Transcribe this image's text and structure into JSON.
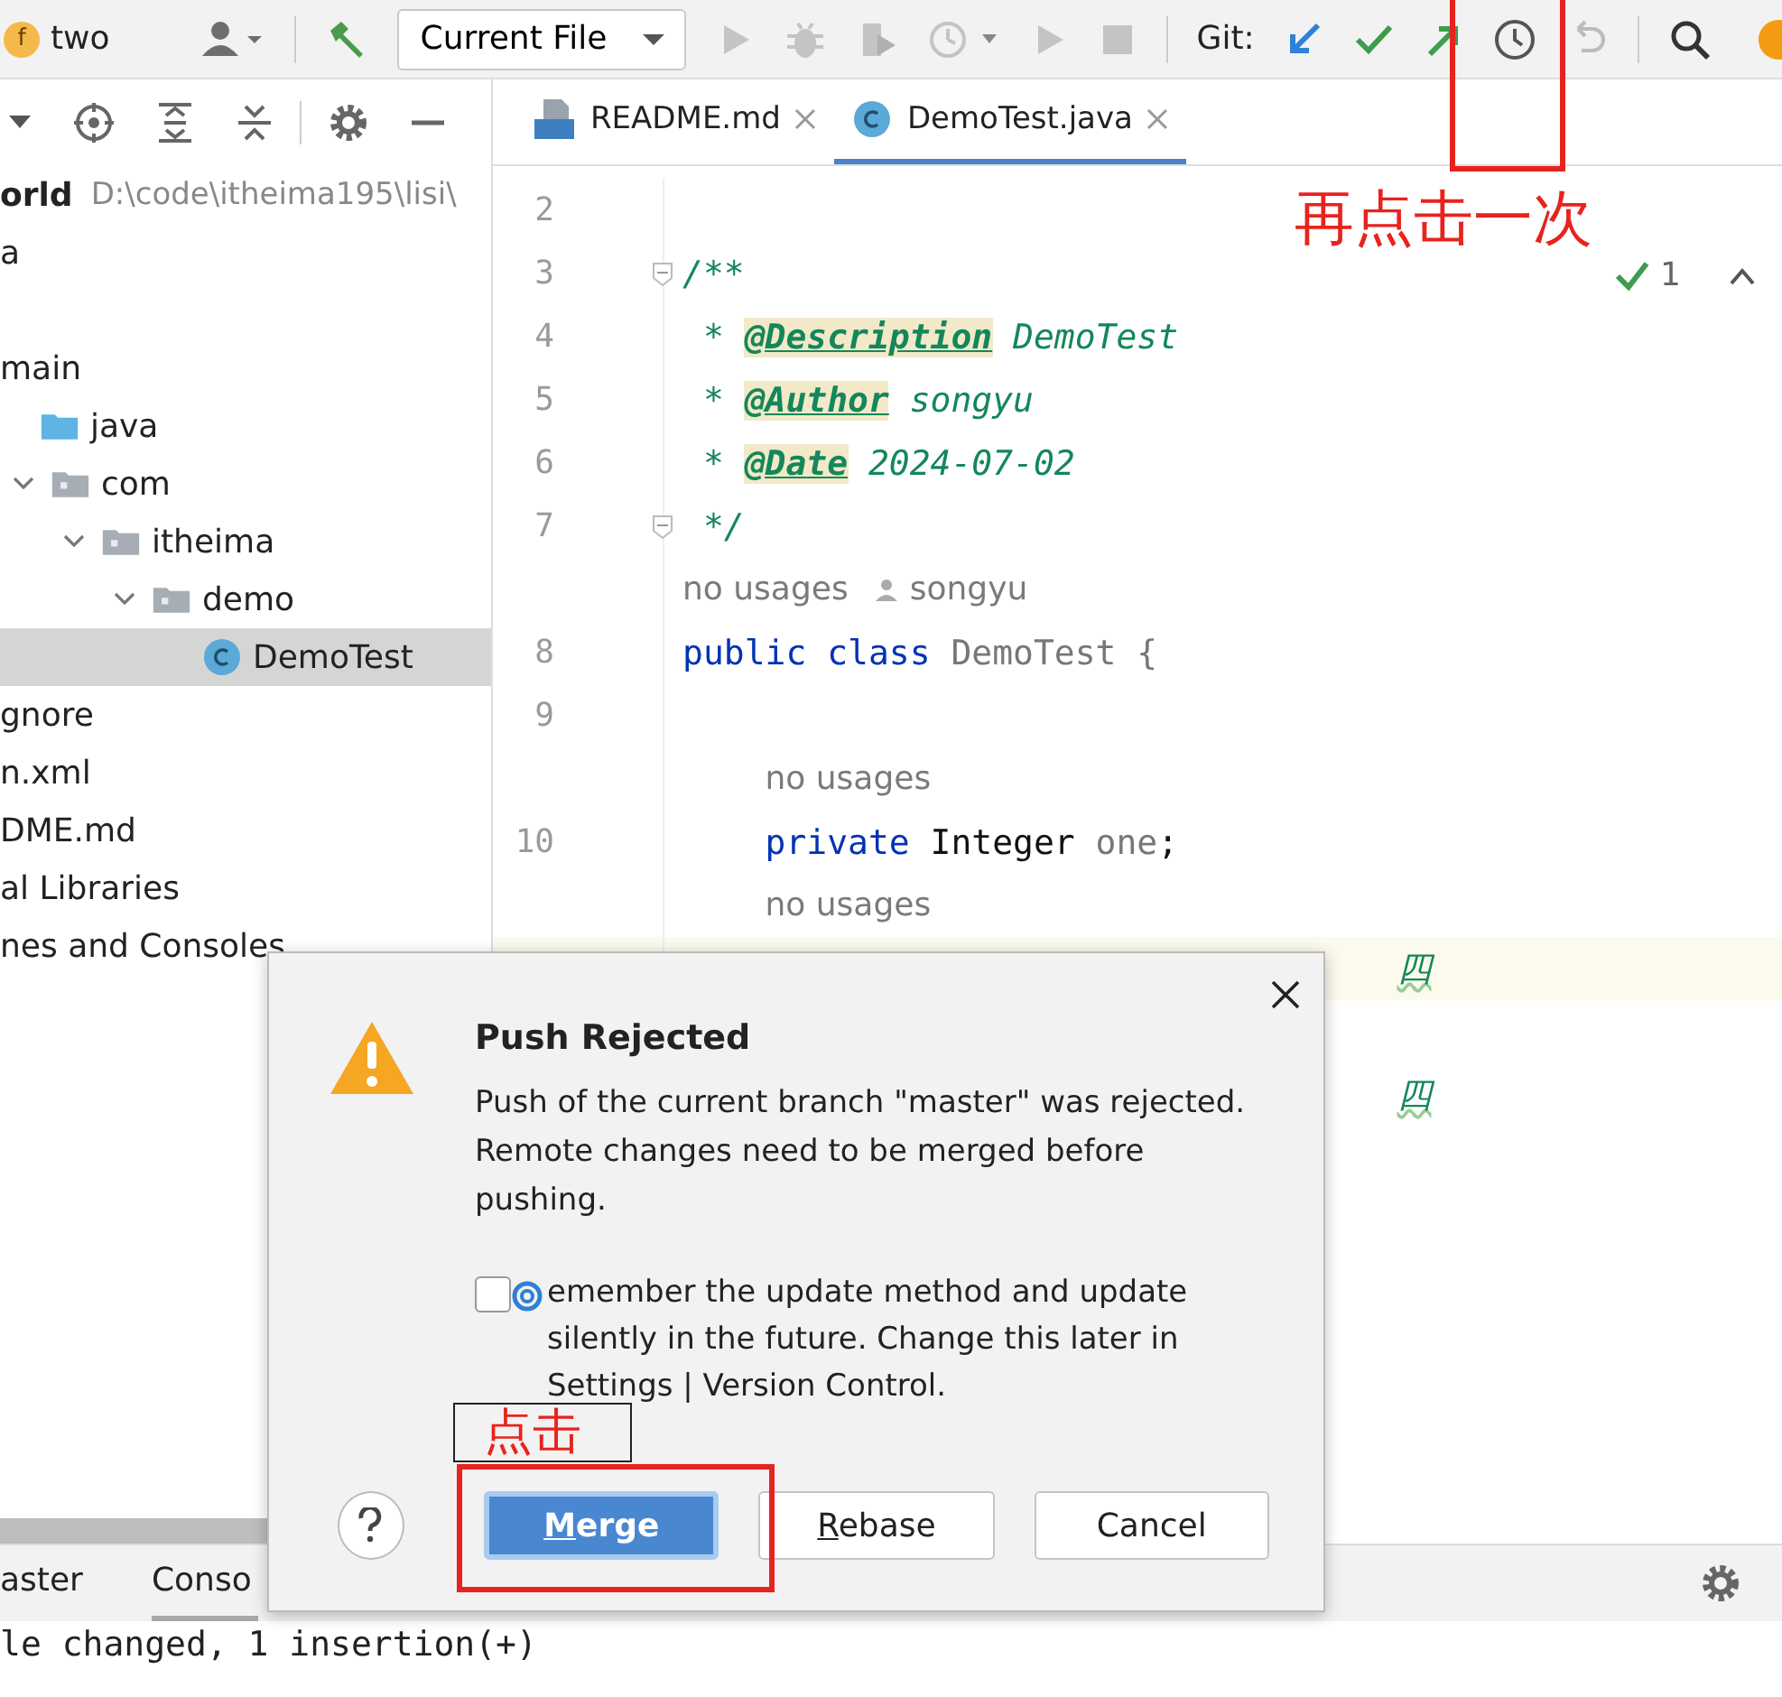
{
  "toolbar": {
    "project_badge": "f",
    "project": "two",
    "run_config": "Current File",
    "git_label": "Git:"
  },
  "project_panel": {
    "tree": [
      {
        "label": "orld",
        "kind": "project",
        "path": "D:\\code\\itheima195\\lisi\\",
        "selected": false
      },
      {
        "label": "a",
        "kind": "text",
        "selected": false
      },
      {
        "label": "main",
        "kind": "text",
        "selected": false,
        "children": [
          {
            "label": "java",
            "kind": "source-folder",
            "selected": false,
            "children": [
              {
                "label": "com",
                "kind": "folder",
                "expanded": true,
                "selected": false,
                "children": [
                  {
                    "label": "itheima",
                    "kind": "folder",
                    "expanded": true,
                    "selected": false,
                    "children": [
                      {
                        "label": "demo",
                        "kind": "folder",
                        "expanded": true,
                        "selected": false,
                        "children": [
                          {
                            "label": "DemoTest",
                            "kind": "class",
                            "selected": true
                          }
                        ]
                      }
                    ]
                  }
                ]
              }
            ]
          }
        ]
      },
      {
        "label": "gnore",
        "kind": "text",
        "selected": false
      },
      {
        "label": "n.xml",
        "kind": "text",
        "selected": false
      },
      {
        "label": "DME.md",
        "kind": "text",
        "selected": false
      },
      {
        "label": "al Libraries",
        "kind": "text",
        "selected": false
      },
      {
        "label": "nes and Consoles",
        "kind": "text",
        "selected": false
      }
    ]
  },
  "editor_tabs": [
    {
      "label": "README.md",
      "kind": "markdown",
      "selected": false
    },
    {
      "label": "DemoTest.java",
      "kind": "class",
      "selected": true
    }
  ],
  "inspection_count": "1",
  "code_lines": [
    {
      "kind": "code",
      "number": "2"
    },
    {
      "kind": "code",
      "number": "3",
      "fold": true,
      "tokens": [
        {
          "kind": "doc",
          "text": "/**"
        }
      ]
    },
    {
      "kind": "code",
      "number": "4",
      "tokens": [
        {
          "kind": "doc",
          "text": " * "
        },
        {
          "kind": "tag",
          "text": "@Description"
        },
        {
          "kind": "doc",
          "text": " DemoTest"
        }
      ]
    },
    {
      "kind": "code",
      "number": "5",
      "tokens": [
        {
          "kind": "doc",
          "text": " * "
        },
        {
          "kind": "tag",
          "text": "@Author"
        },
        {
          "kind": "doc",
          "text": " songyu"
        }
      ]
    },
    {
      "kind": "code",
      "number": "6",
      "tokens": [
        {
          "kind": "doc",
          "text": " * "
        },
        {
          "kind": "tag",
          "text": "@Date"
        },
        {
          "kind": "doc",
          "text": " 2024-07-02"
        }
      ]
    },
    {
      "kind": "code",
      "number": "7",
      "fold": true,
      "tokens": [
        {
          "kind": "doc",
          "text": " */"
        }
      ]
    },
    {
      "kind": "code",
      "number": "8",
      "hint": "no usages",
      "author": "songyu",
      "tokens": [
        {
          "kind": "keyword",
          "text": "public class "
        },
        {
          "kind": "unused",
          "text": "DemoTest {"
        }
      ],
      "children": [
        {
          "kind": "code",
          "number": "9"
        },
        {
          "kind": "code",
          "number": "10",
          "hint": "no usages",
          "tokens": [
            {
              "kind": "keyword",
              "text": "private "
            },
            {
              "kind": "plain",
              "text": "Integer "
            },
            {
              "kind": "unused",
              "text": "one"
            },
            {
              "kind": "plain",
              "text": ";"
            }
          ]
        },
        {
          "kind": "obscured",
          "hint": "no usages",
          "current": true,
          "tokens": [
            {
              "kind": "string",
              "text": "四"
            }
          ]
        },
        {
          "kind": "obscured",
          "current": false,
          "tokens": [
            {
              "kind": "string",
              "text": "四"
            }
          ]
        }
      ]
    }
  ],
  "bottom_tabs": [
    {
      "label": "aster",
      "selected": false
    },
    {
      "label": "Conso",
      "selected": true
    }
  ],
  "console_lines": [
    "le changed, 1 insertion(+)"
  ],
  "dialog": {
    "title": "Push Rejected",
    "message": "Push of the current branch \"master\" was rejected. Remote changes need to be merged before pushing.",
    "remember": {
      "checked": false,
      "label": "emember the update method and update silently in the future. Change this later in Settings | Version Control."
    },
    "buttons": [
      {
        "label": "Merge",
        "default": true,
        "mnemonic": true
      },
      {
        "label": "Rebase",
        "default": false,
        "mnemonic": true
      },
      {
        "label": "Cancel",
        "default": false,
        "mnemonic": false
      }
    ]
  },
  "annotations": [
    {
      "kind": "callout",
      "text": "再点击一次"
    },
    {
      "kind": "callout",
      "text": "点击"
    }
  ]
}
